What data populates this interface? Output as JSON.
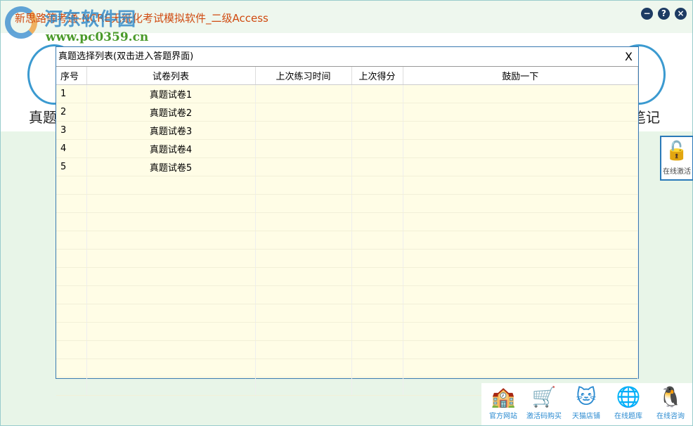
{
  "window": {
    "title": "新思路等考通-NCRE无纸化考试模拟软件_二级Access",
    "watermark": "河东软件园",
    "watermark_url": "www.pc0359.cn",
    "buttons": {
      "minimize": "−",
      "help": "?",
      "close": "×"
    }
  },
  "main": {
    "left_label": "真题",
    "right_label": "笔记"
  },
  "activate": {
    "label": "在线激活"
  },
  "dialog": {
    "title": "真题选择列表(双击进入答题界面)",
    "close": "X",
    "columns": [
      "序号",
      "试卷列表",
      "上次练习时间",
      "上次得分",
      "鼓励一下"
    ],
    "rows": [
      {
        "no": "1",
        "name": "真题试卷1",
        "time": "",
        "score": "",
        "note": ""
      },
      {
        "no": "2",
        "name": "真题试卷2",
        "time": "",
        "score": "",
        "note": ""
      },
      {
        "no": "3",
        "name": "真题试卷3",
        "time": "",
        "score": "",
        "note": ""
      },
      {
        "no": "4",
        "name": "真题试卷4",
        "time": "",
        "score": "",
        "note": ""
      },
      {
        "no": "5",
        "name": "真题试卷5",
        "time": "",
        "score": "",
        "note": ""
      }
    ]
  },
  "bottom": {
    "items": [
      {
        "label": "官方网站",
        "icon": "house-icon"
      },
      {
        "label": "激活码购买",
        "icon": "cart-icon"
      },
      {
        "label": "天猫店铺",
        "icon": "tmall-cat-icon"
      },
      {
        "label": "在线题库",
        "icon": "globe-student-icon"
      },
      {
        "label": "在线咨询",
        "icon": "qq-penguin-icon"
      }
    ]
  }
}
